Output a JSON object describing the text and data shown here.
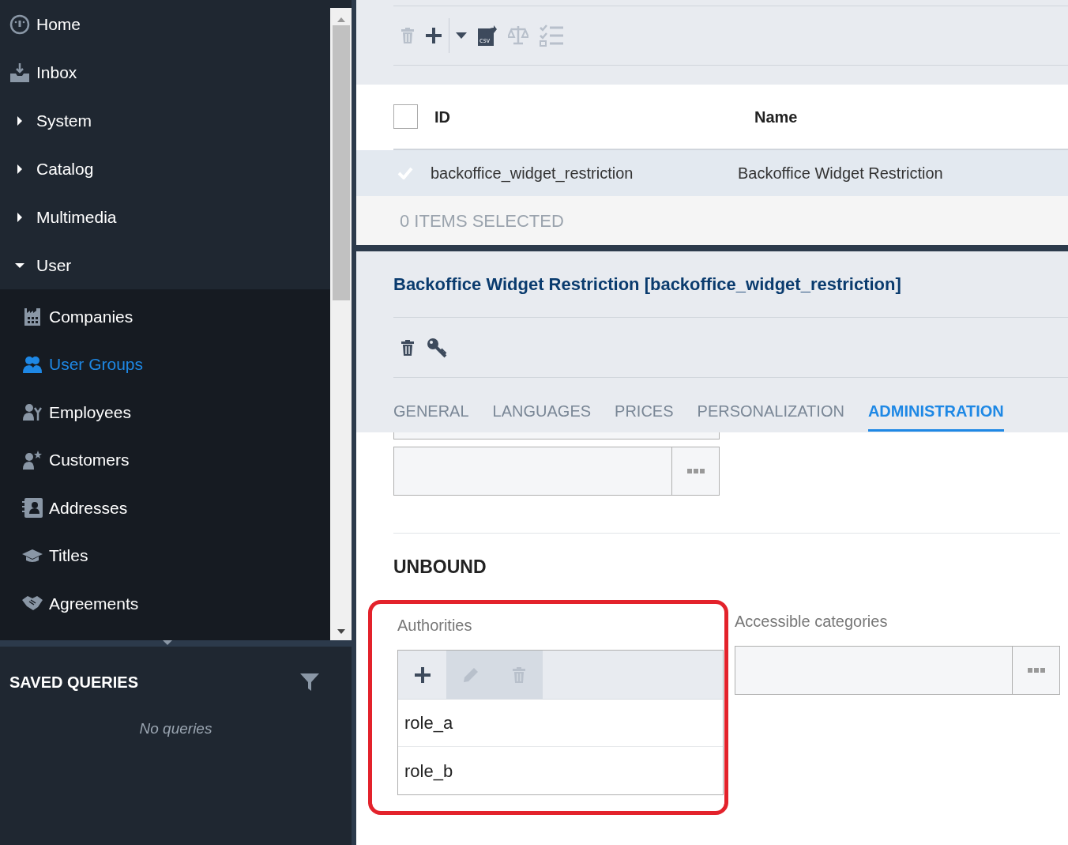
{
  "sidebar": {
    "nav": [
      {
        "label": "Home",
        "kind": "link"
      },
      {
        "label": "Inbox",
        "kind": "link"
      },
      {
        "label": "System",
        "kind": "group",
        "expanded": false
      },
      {
        "label": "Catalog",
        "kind": "group",
        "expanded": false
      },
      {
        "label": "Multimedia",
        "kind": "group",
        "expanded": false
      },
      {
        "label": "User",
        "kind": "group",
        "expanded": true,
        "children": [
          {
            "label": "Companies",
            "selected": false
          },
          {
            "label": "User Groups",
            "selected": true
          },
          {
            "label": "Employees",
            "selected": false
          },
          {
            "label": "Customers",
            "selected": false
          },
          {
            "label": "Addresses",
            "selected": false
          },
          {
            "label": "Titles",
            "selected": false
          },
          {
            "label": "Agreements",
            "selected": false
          }
        ]
      }
    ],
    "saved_queries": {
      "title": "SAVED QUERIES",
      "empty_text": "No queries"
    }
  },
  "list_toolbar": [
    {
      "kind": "delete",
      "disabled": true
    },
    {
      "kind": "add",
      "disabled": false
    },
    {
      "kind": "dropdown",
      "disabled": false
    },
    {
      "kind": "csv",
      "disabled": false
    },
    {
      "kind": "compare",
      "disabled": true
    },
    {
      "kind": "checklist",
      "disabled": true
    }
  ],
  "table": {
    "select_all": {
      "checked": false
    },
    "columns": [
      "ID",
      "Name"
    ],
    "rows": [
      {
        "cells": [
          "backoffice_widget_restriction",
          "Backoffice Widget Restriction"
        ],
        "selected": true
      }
    ],
    "footer": "0 ITEMS SELECTED"
  },
  "detail": {
    "title": "Backoffice Widget Restriction [backoffice_widget_restriction]",
    "toolbar": [
      {
        "kind": "delete",
        "disabled": false
      },
      {
        "kind": "key",
        "disabled": false
      }
    ],
    "tabs": [
      {
        "label": "GENERAL",
        "selected": false
      },
      {
        "label": "LANGUAGES",
        "selected": false
      },
      {
        "label": "PRICES",
        "selected": false
      },
      {
        "label": "PERSONALIZATION",
        "selected": false
      },
      {
        "label": "ADMINISTRATION",
        "selected": true
      }
    ],
    "section": "UNBOUND",
    "authorities": {
      "label": "Authorities",
      "highlighted": true,
      "toolbar": [
        {
          "kind": "add",
          "disabled": false
        },
        {
          "kind": "edit",
          "disabled": true
        },
        {
          "kind": "delete",
          "disabled": true
        }
      ],
      "items": [
        "role_a",
        "role_b"
      ]
    },
    "accessible_categories": {
      "label": "Accessible categories"
    }
  }
}
